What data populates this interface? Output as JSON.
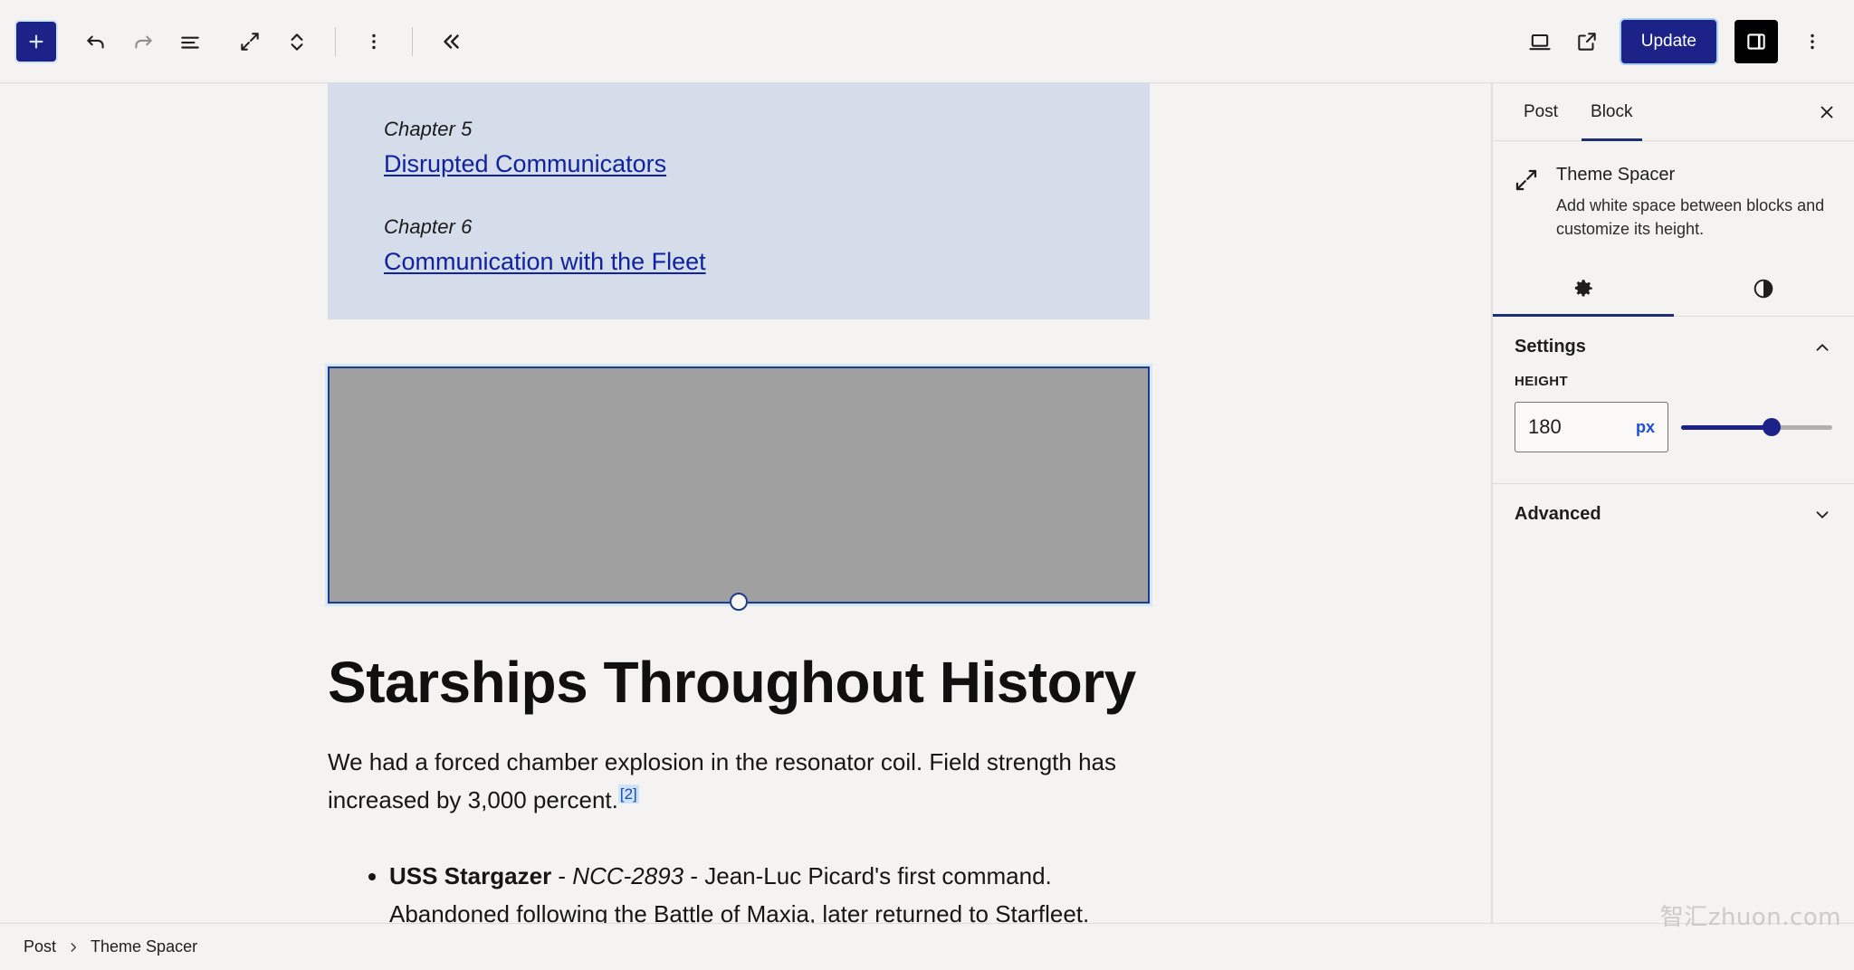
{
  "toolbar": {
    "add_block_label": "+",
    "add_block_icon": "plus-icon",
    "undo_icon": "undo-arrow-icon",
    "redo_icon": "redo-arrow-icon",
    "list_view_icon": "document-outline-icon",
    "expand_icon": "diagonal-arrows-icon",
    "updown_icon": "chevron-up-down-icon",
    "options_icon": "vertical-dots-icon",
    "collapse_icon": "double-chevron-left-icon",
    "preview_icon": "desktop-device-icon",
    "view_external_icon": "external-link-icon",
    "update_label": "Update",
    "sidebar_toggle_icon": "sidebar-panel-icon",
    "more_options_icon": "vertical-dots-icon"
  },
  "content": {
    "toc": {
      "entries": [
        {
          "chapter": "Chapter 5",
          "link": "Disrupted Communicators"
        },
        {
          "chapter": "Chapter 6",
          "link": "Communication with the Fleet"
        }
      ]
    },
    "spacer": {
      "name": "Theme Spacer block",
      "handle_icon": "resize-handle-icon",
      "fill_color": "#a0a0a0",
      "selection_color": "#1d3c8e"
    },
    "heading": "Starships Throughout History",
    "paragraph": "We had a forced chamber explosion in the resonator coil. Field strength has increased by 3,000 percent.",
    "footnote_marker": "[2]",
    "list_items": [
      {
        "title": "USS Stargazer",
        "sep1": " - ",
        "designation": "NCC-2893",
        "sep2": " - ",
        "rest": "Jean-Luc Picard's first command. Abandoned following the Battle of Maxia, later returned to Starfleet."
      }
    ]
  },
  "sidebar": {
    "tabs": [
      {
        "label": "Post",
        "active": false
      },
      {
        "label": "Block",
        "active": true
      }
    ],
    "close_icon": "close-x-icon",
    "block": {
      "icon": "theme-spacer-icon",
      "title": "Theme Spacer",
      "description": "Add white space between blocks and customize its height."
    },
    "icon_tabs": [
      {
        "icon": "gear-icon",
        "name": "settings",
        "active": true
      },
      {
        "icon": "contrast-half-circle-icon",
        "name": "styles",
        "active": false
      }
    ],
    "panels": [
      {
        "title": "Settings",
        "expanded": true,
        "chevron": "chevron-up-icon"
      },
      {
        "title": "Advanced",
        "expanded": false,
        "chevron": "chevron-down-icon"
      }
    ],
    "height_control": {
      "label": "HEIGHT",
      "value": "180",
      "unit": "px",
      "slider_percent": 60
    }
  },
  "footer": {
    "breadcrumb": [
      "Post",
      "Theme Spacer"
    ],
    "separator": "›"
  },
  "watermark": "智汇zhuon.com",
  "colors": {
    "accent": "#1d2288",
    "link": "#10239e",
    "toc_bg": "#d6ddea",
    "canvas_bg": "#f4f3f1"
  }
}
